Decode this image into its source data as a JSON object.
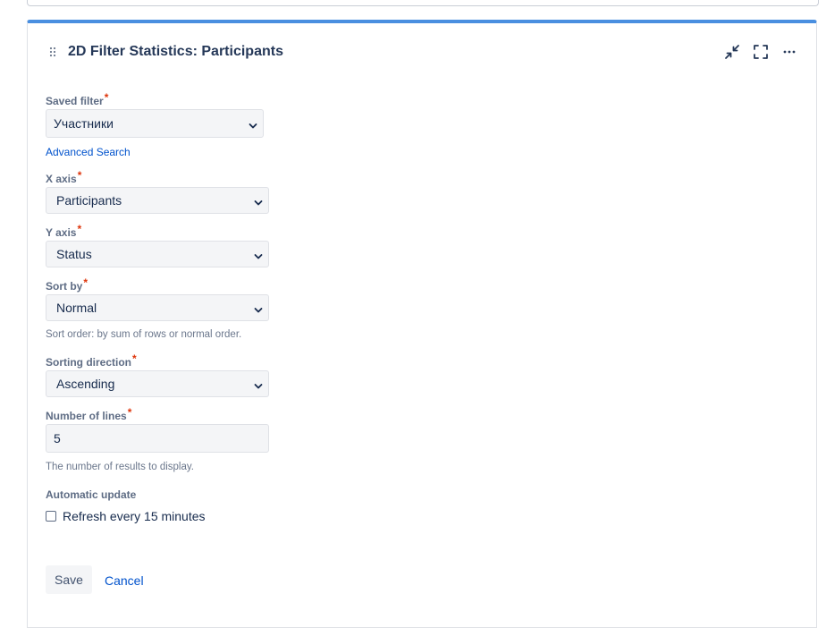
{
  "gadget": {
    "title": "2D Filter Statistics: Participants",
    "accent_color": "#4a8fe0",
    "icons": [
      "drag-handle-icon",
      "minimize-icon",
      "fullscreen-icon",
      "more-icon"
    ]
  },
  "form": {
    "saved_filter": {
      "label": "Saved filter",
      "required_mark": "*",
      "value": "Участники",
      "link": "Advanced Search"
    },
    "x_axis": {
      "label": "X axis",
      "required_mark": "*",
      "value": "Participants"
    },
    "y_axis": {
      "label": "Y axis",
      "required_mark": "*",
      "value": "Status"
    },
    "sort_by": {
      "label": "Sort by",
      "required_mark": "*",
      "value": "Normal",
      "help": "Sort order: by sum of rows or normal order."
    },
    "sorting_direction": {
      "label": "Sorting direction",
      "required_mark": "*",
      "value": "Ascending"
    },
    "number_of_lines": {
      "label": "Number of lines",
      "required_mark": "*",
      "value": "5",
      "help": "The number of results to display."
    },
    "automatic_update": {
      "label": "Automatic update",
      "checkbox_label": "Refresh every 15 minutes",
      "checked": false
    },
    "actions": {
      "save_label": "Save",
      "cancel_label": "Cancel"
    }
  }
}
